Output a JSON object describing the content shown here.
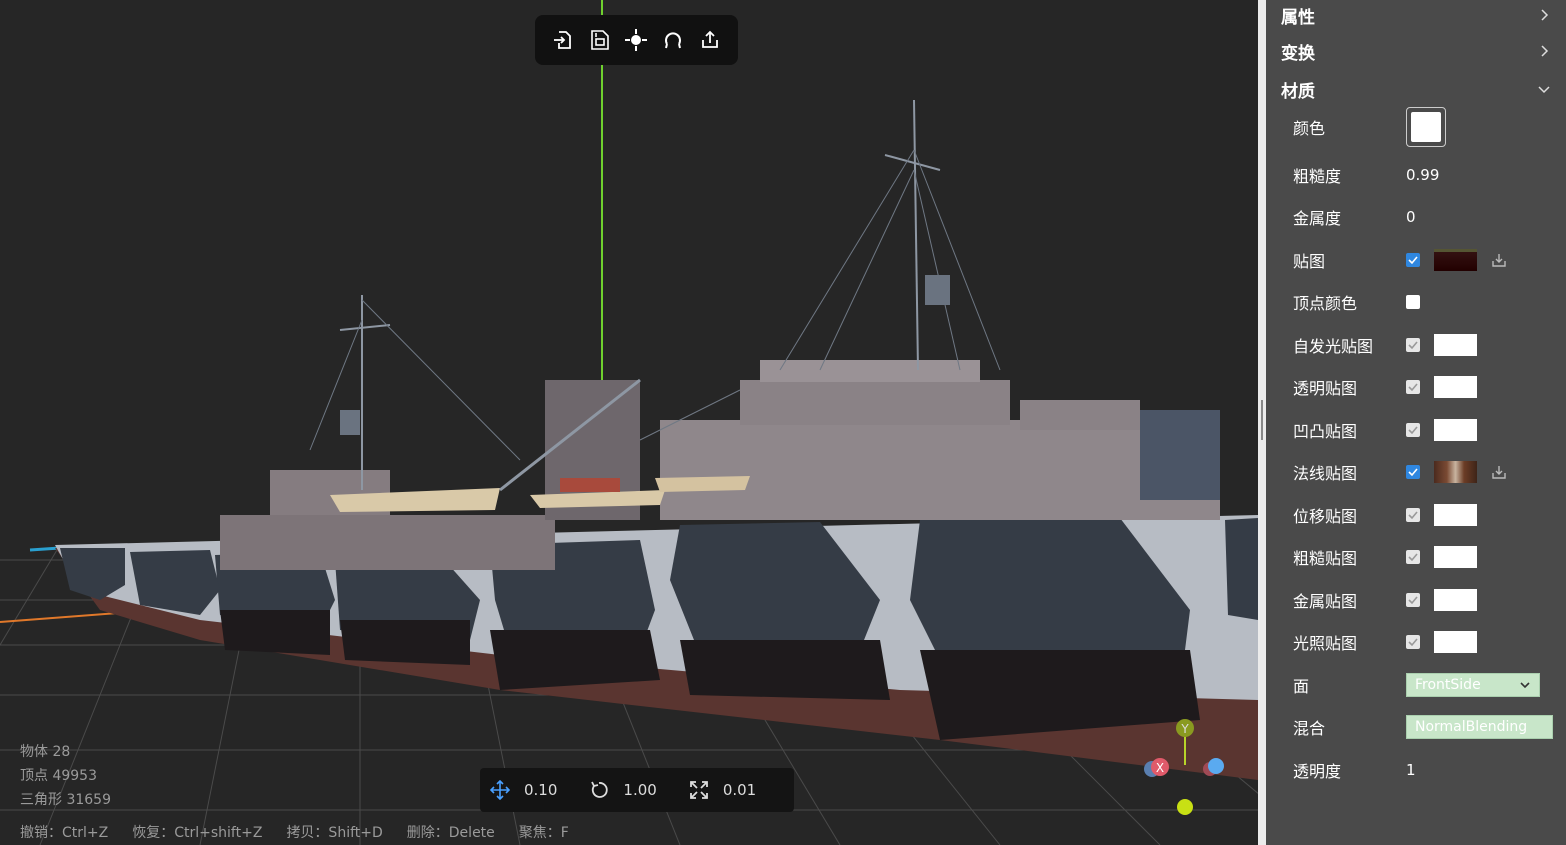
{
  "toolbar": {
    "buttons": [
      {
        "name": "import-icon"
      },
      {
        "name": "import-zip-icon"
      },
      {
        "name": "focus-icon"
      },
      {
        "name": "reset-icon"
      },
      {
        "name": "export-icon"
      }
    ]
  },
  "stats": {
    "objects": "物体 28",
    "vertices": "顶点 49953",
    "triangles": "三角形 31659"
  },
  "shortcuts": {
    "undo": "撤销：Ctrl+Z",
    "redo": "恢复：Ctrl+shift+Z",
    "copy": "拷贝：Shift+D",
    "delete": "删除：Delete",
    "focus": "聚焦：F"
  },
  "snap": {
    "translate": "0.10",
    "rotate": "1.00",
    "scale": "0.01"
  },
  "gizmo": {
    "y_label": "Y",
    "x_label": "X"
  },
  "panel": {
    "sections": {
      "properties": "属性",
      "transform": "变换",
      "material": "材质"
    },
    "material": {
      "color_label": "颜色",
      "roughness_label": "粗糙度",
      "roughness_value": "0.99",
      "metalness_label": "金属度",
      "metalness_value": "0",
      "map_label": "贴图",
      "vertex_colors_label": "顶点颜色",
      "emissive_map_label": "自发光贴图",
      "alpha_map_label": "透明贴图",
      "bump_map_label": "凹凸贴图",
      "normal_map_label": "法线贴图",
      "displacement_map_label": "位移贴图",
      "roughness_map_label": "粗糙贴图",
      "metalness_map_label": "金属贴图",
      "light_map_label": "光照贴图",
      "side_label": "面",
      "side_value": "FrontSide",
      "blending_label": "混合",
      "blending_value": "NormalBlending",
      "opacity_label": "透明度",
      "opacity_value": "1"
    }
  },
  "colors": {
    "accent": "#2f87e0",
    "panel_bg": "#4a4a4a",
    "viewport_bg": "#262626",
    "select_bg": "#c8e6c9"
  }
}
